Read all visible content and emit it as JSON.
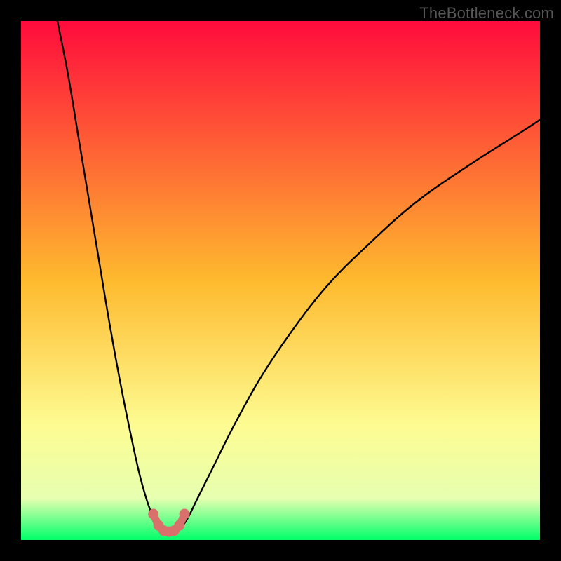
{
  "watermark": "TheBottleneck.com",
  "colors": {
    "frame": "#000000",
    "gradient_top": "#ff0b3c",
    "gradient_mid": "#feba2e",
    "gradient_low": "#fdfc92",
    "gradient_near_bottom": "#e6ffb0",
    "gradient_bottom": "#00ff6a",
    "curve": "#000000",
    "marker": "#d9706c",
    "watermark": "#575757"
  },
  "chart_data": {
    "type": "line",
    "title": "",
    "xlabel": "",
    "ylabel": "",
    "xlim": [
      0,
      100
    ],
    "ylim": [
      0,
      100
    ],
    "grid": false,
    "legend": false,
    "series": [
      {
        "name": "left-branch",
        "x": [
          7,
          9,
          11,
          13,
          15,
          17,
          19,
          21,
          23,
          25,
          26.5,
          27.5
        ],
        "y": [
          100,
          90,
          78,
          66,
          54,
          42,
          31,
          21,
          12,
          5.5,
          3,
          2
        ]
      },
      {
        "name": "right-branch",
        "x": [
          30.5,
          32,
          34,
          37,
          41,
          46,
          52,
          59,
          67,
          76,
          86,
          97,
          100
        ],
        "y": [
          2,
          4,
          8,
          14,
          22,
          31,
          40,
          49,
          57,
          65,
          72,
          79,
          81
        ]
      },
      {
        "name": "u-valley",
        "x": [
          25.5,
          26.5,
          27.5,
          28.5,
          29.5,
          30.5,
          31.5
        ],
        "y": [
          5.0,
          2.8,
          1.8,
          1.6,
          1.8,
          2.8,
          5.0
        ]
      }
    ],
    "background_gradient_stops": [
      {
        "pct": 0,
        "color": "#ff0b3c"
      },
      {
        "pct": 50,
        "color": "#feba2e"
      },
      {
        "pct": 78,
        "color": "#fdfc92"
      },
      {
        "pct": 92,
        "color": "#e6ffb0"
      },
      {
        "pct": 100,
        "color": "#00ff6a"
      }
    ],
    "optimum_x": 28.5
  }
}
